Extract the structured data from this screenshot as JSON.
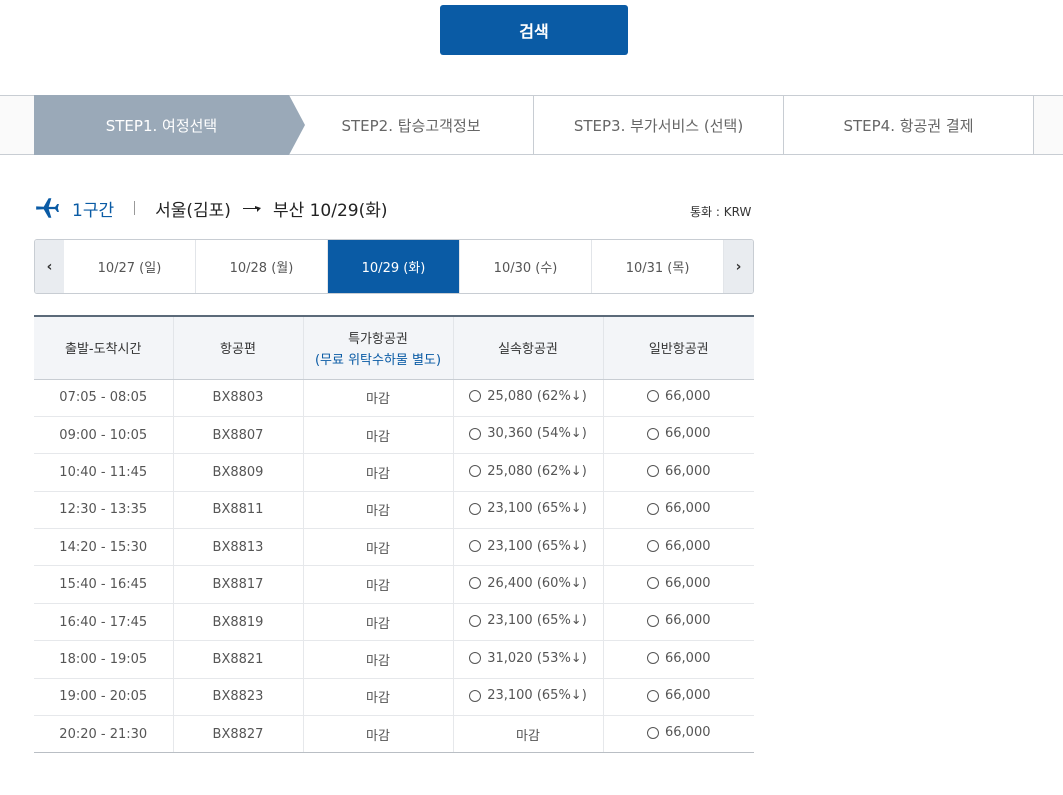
{
  "search": {
    "label": "검색"
  },
  "steps": [
    {
      "label": "STEP1. 여정선택"
    },
    {
      "label": "STEP2. 탑승고객정보"
    },
    {
      "label": "STEP3. 부가서비스 (선택)"
    },
    {
      "label": "STEP4. 항공권 결제"
    }
  ],
  "route": {
    "segment": "1구간",
    "origin": "서울(김포)",
    "destination": "부산 10/29(화)"
  },
  "currency": "통화 : KRW",
  "dates": [
    {
      "label": "10/27 (일)"
    },
    {
      "label": "10/28 (월)"
    },
    {
      "label": "10/29 (화)"
    },
    {
      "label": "10/30 (수)"
    },
    {
      "label": "10/31 (목)"
    }
  ],
  "table": {
    "headers": {
      "time": "출발-도착시간",
      "flight": "항공편",
      "special": "특가항공권",
      "special_note": "(무료 위탁수하물 별도)",
      "discount": "실속항공권",
      "normal": "일반항공권"
    },
    "rows": [
      {
        "time": "07:05 - 08:05",
        "flight": "BX8803",
        "special": "마감",
        "discount": "25,080 (62%↓)",
        "normal": "66,000"
      },
      {
        "time": "09:00 - 10:05",
        "flight": "BX8807",
        "special": "마감",
        "discount": "30,360 (54%↓)",
        "normal": "66,000"
      },
      {
        "time": "10:40 - 11:45",
        "flight": "BX8809",
        "special": "마감",
        "discount": "25,080 (62%↓)",
        "normal": "66,000"
      },
      {
        "time": "12:30 - 13:35",
        "flight": "BX8811",
        "special": "마감",
        "discount": "23,100 (65%↓)",
        "normal": "66,000"
      },
      {
        "time": "14:20 - 15:30",
        "flight": "BX8813",
        "special": "마감",
        "discount": "23,100 (65%↓)",
        "normal": "66,000"
      },
      {
        "time": "15:40 - 16:45",
        "flight": "BX8817",
        "special": "마감",
        "discount": "26,400 (60%↓)",
        "normal": "66,000"
      },
      {
        "time": "16:40 - 17:45",
        "flight": "BX8819",
        "special": "마감",
        "discount": "23,100 (65%↓)",
        "normal": "66,000"
      },
      {
        "time": "18:00 - 19:05",
        "flight": "BX8821",
        "special": "마감",
        "discount": "31,020 (53%↓)",
        "normal": "66,000"
      },
      {
        "time": "19:00 - 20:05",
        "flight": "BX8823",
        "special": "마감",
        "discount": "23,100 (65%↓)",
        "normal": "66,000"
      },
      {
        "time": "20:20 - 21:30",
        "flight": "BX8827",
        "special": "마감",
        "discount": "마감",
        "normal": "66,000"
      }
    ]
  }
}
